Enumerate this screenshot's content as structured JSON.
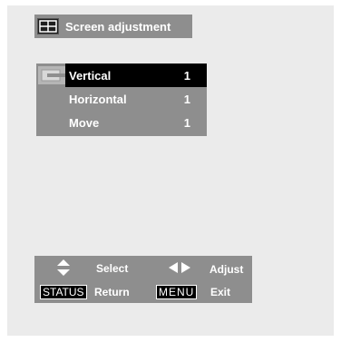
{
  "title": "Screen adjustment",
  "menu": {
    "rows": [
      {
        "label": "Vertical",
        "value": "1",
        "selected": true
      },
      {
        "label": "Horizontal",
        "value": "1",
        "selected": false
      },
      {
        "label": "Move",
        "value": "1",
        "selected": false
      }
    ]
  },
  "help": {
    "select_label": "Select",
    "adjust_label": "Adjust",
    "status_key": "STATUS",
    "return_label": "Return",
    "menu_key": "MENU",
    "exit_label": "Exit"
  },
  "icons": {
    "title": "screen-grid-icon",
    "menu": "tab-cursor-icon",
    "select": "up-down-arrows-icon",
    "adjust": "left-right-arrows-icon"
  },
  "colors": {
    "panel_bg": "#ebebeb",
    "bar_gray": "#8e8e8e",
    "highlight": "#000000",
    "text": "#ffffff"
  }
}
